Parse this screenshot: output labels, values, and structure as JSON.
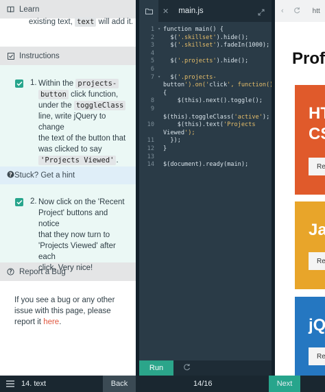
{
  "learn": {
    "label": "Learn",
    "text_prefix": "existing text,",
    "code": "text",
    "text_suffix": "will add it."
  },
  "instructions": {
    "label": "Instructions",
    "task1": {
      "num": "1.",
      "l1_a": "Within the",
      "l1_code": "projects-",
      "l2_code": "button",
      "l2_b": "click function,",
      "l3": "under the",
      "l3_code": "toggleClass",
      "l4": "line, write jQuery to change",
      "l5": "the text of the button that",
      "l6": "was clicked to say",
      "l7_code": "'Projects Viewed'",
      "l7_end": "."
    }
  },
  "hint": {
    "label": "Stuck? Get a hint",
    "task2": {
      "num": "2.",
      "lines": [
        "Now click on the 'Recent",
        "Project' buttons and notice",
        "that they now turn to",
        "'Projects Viewed' after each",
        "click. Very nice!"
      ]
    }
  },
  "bug": {
    "label": "Report a Bug",
    "text": "If you see a bug or any other issue with this page, please report it ",
    "link": "here",
    "end": "."
  },
  "editor": {
    "filename": "main.js",
    "run_label": "Run",
    "lines": [
      {
        "n": "1",
        "text": "function main() {"
      },
      {
        "n": "2",
        "text": "  $('.skillset').hide();"
      },
      {
        "n": "3",
        "text": "  $('.skillset').fadeIn(1000);"
      },
      {
        "n": "4",
        "text": ""
      },
      {
        "n": "5",
        "text": "  $('.projects').hide();"
      },
      {
        "n": "6",
        "text": ""
      },
      {
        "n": "7",
        "text": "  $('.projects-"
      },
      {
        "n": "",
        "text": "button').on('click', function()"
      },
      {
        "n": "",
        "text": "{"
      },
      {
        "n": "8",
        "text": "    $(this).next().toggle();"
      },
      {
        "n": "9",
        "text": ""
      },
      {
        "n": "",
        "text": "$(this).toggleClass('active');"
      },
      {
        "n": "10",
        "text": "    $(this).text('Projects"
      },
      {
        "n": "",
        "text": "Viewed');"
      },
      {
        "n": "11",
        "text": "  });"
      },
      {
        "n": "12",
        "text": "}"
      },
      {
        "n": "13",
        "text": ""
      },
      {
        "n": "14",
        "text": "$(document).ready(main);"
      }
    ]
  },
  "preview": {
    "url": "htt",
    "title": "Prof",
    "cards": [
      {
        "title_l1": "HT",
        "title_l2": "CS",
        "button": "Re",
        "color": "#e05a2b"
      },
      {
        "title_l1": "Ja",
        "title_l2": "",
        "button": "Re",
        "color": "#e8a52a"
      },
      {
        "title_l1": "jQ",
        "title_l2": "",
        "button": "Re",
        "color": "#2577c1"
      }
    ]
  },
  "bottom": {
    "lesson": "14. text",
    "back": "Back",
    "page": "14/16",
    "next": "Next"
  },
  "colors": {
    "accent": "#27a58c",
    "link": "#e0573f"
  }
}
